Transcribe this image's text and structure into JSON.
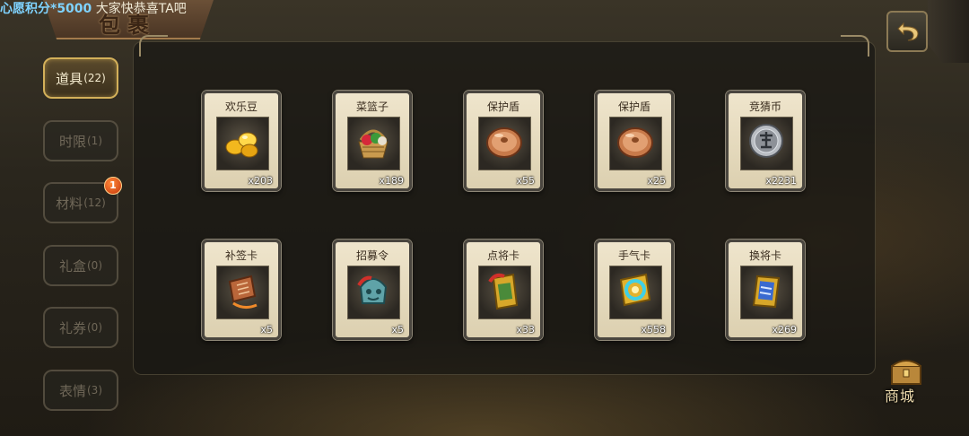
{
  "marquee": {
    "highlight": "心愿积分*5000",
    "message": "大家快恭喜TA吧"
  },
  "header": {
    "title": "包裹"
  },
  "back_icon": "back-arrow-icon",
  "tabs": [
    {
      "label": "道具",
      "count": "(22)",
      "active": true
    },
    {
      "label": "时限",
      "count": "(1)",
      "active": false
    },
    {
      "label": "材料",
      "count": "(12)",
      "active": false,
      "badge": "1"
    },
    {
      "label": "礼盒",
      "count": "(0)",
      "active": false
    },
    {
      "label": "礼券",
      "count": "(0)",
      "active": false
    },
    {
      "label": "表情",
      "count": "(3)",
      "active": false
    }
  ],
  "items": [
    {
      "name": "欢乐豆",
      "qty": "x203",
      "icon": "gold-beans-icon"
    },
    {
      "name": "菜篮子",
      "qty": "x189",
      "icon": "vegetable-basket-icon"
    },
    {
      "name": "保护盾",
      "qty": "x55",
      "icon": "shield-icon"
    },
    {
      "name": "保护盾",
      "qty": "x25",
      "icon": "shield-icon"
    },
    {
      "name": "竞猜币",
      "qty": "x2231",
      "icon": "silver-coin-icon"
    },
    {
      "name": "补签卡",
      "qty": "x5",
      "icon": "signin-card-icon"
    },
    {
      "name": "招募令",
      "qty": "x5",
      "icon": "recruit-token-icon"
    },
    {
      "name": "点将卡",
      "qty": "x33",
      "icon": "general-card-icon"
    },
    {
      "name": "手气卡",
      "qty": "x558",
      "icon": "luck-card-icon"
    },
    {
      "name": "换将卡",
      "qty": "x269",
      "icon": "swap-general-card-icon"
    }
  ],
  "shop": {
    "label": "商城",
    "icon": "shop-chest-icon"
  }
}
